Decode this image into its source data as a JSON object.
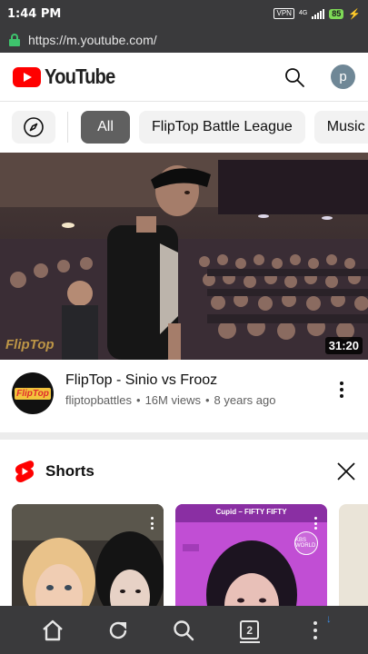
{
  "status_bar": {
    "time": "1:44 PM",
    "vpn": "VPN",
    "network": "4G",
    "battery": "85"
  },
  "browser": {
    "url": "https://m.youtube.com/"
  },
  "header": {
    "logo_text": "YouTube",
    "avatar_letter": "p"
  },
  "chips": [
    "All",
    "FlipTop Battle League",
    "Music"
  ],
  "video": {
    "duration": "31:20",
    "thumbnail_watermark": "FlipTop",
    "title": "FlipTop - Sinio vs Frooz",
    "channel": "fliptopbattles",
    "views": "16M views",
    "age": "8 years ago",
    "channel_avatar_text": "FlipTop"
  },
  "shorts": {
    "heading": "Shorts",
    "cards": [
      {
        "caption": ""
      },
      {
        "caption": "Cupid – FIFTY FIFTY",
        "badge": "KBS WORLD"
      },
      {
        "caption": ""
      }
    ]
  },
  "bottom_bar": {
    "tab_count": "2"
  },
  "colors": {
    "brand_red": "#ff0000",
    "chrome_dark": "#3a3a3c",
    "lock_green": "#3ec46d",
    "battery_green": "#7ed957",
    "active_chip": "#606060"
  }
}
